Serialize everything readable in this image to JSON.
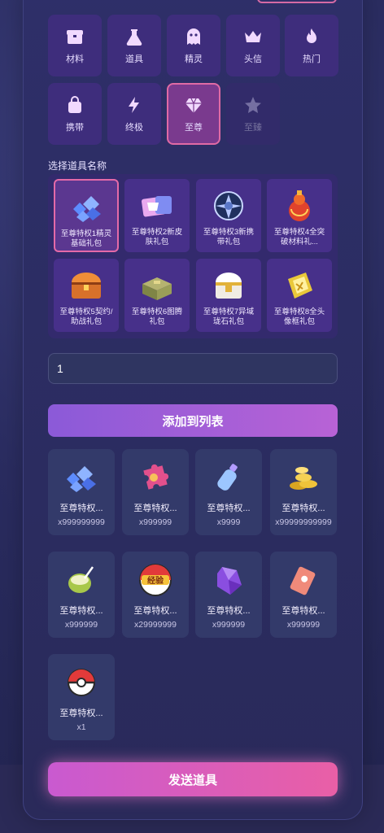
{
  "categories": [
    {
      "label": "材料",
      "icon": "box-icon",
      "state": "normal"
    },
    {
      "label": "道具",
      "icon": "flask-icon",
      "state": "normal"
    },
    {
      "label": "精灵",
      "icon": "ghost-icon",
      "state": "normal"
    },
    {
      "label": "头信",
      "icon": "crown-icon",
      "state": "normal"
    },
    {
      "label": "热门",
      "icon": "fire-icon",
      "state": "normal"
    },
    {
      "label": "携带",
      "icon": "bag-icon",
      "state": "normal"
    },
    {
      "label": "终极",
      "icon": "bolt-icon",
      "state": "normal"
    },
    {
      "label": "至尊",
      "icon": "diamond-icon",
      "state": "active"
    },
    {
      "label": "至臻",
      "icon": "star-icon",
      "state": "disabled"
    }
  ],
  "item_section_label": "选择道具名称",
  "packages": [
    {
      "name": "至尊特权1精灵基础礼包",
      "icon": "blue-crystals-icon",
      "selected": true
    },
    {
      "name": "至尊特权2新皮肤礼包",
      "icon": "skin-ticket-icon",
      "selected": false
    },
    {
      "name": "至尊特权3新携带礼包",
      "icon": "dark-star-badge-icon",
      "selected": false
    },
    {
      "name": "至尊特权4全突破材料礼...",
      "icon": "red-gourd-icon",
      "selected": false
    },
    {
      "name": "至尊特权5契约/助战礼包",
      "icon": "orange-chest-icon",
      "selected": false
    },
    {
      "name": "至尊特权6图腾礼包",
      "icon": "green-chest-icon",
      "selected": false
    },
    {
      "name": "至尊特权7异域珑石礼包",
      "icon": "gold-white-chest-icon",
      "selected": false
    },
    {
      "name": "至尊特权8全头像框礼包",
      "icon": "gold-frame-icon",
      "selected": false
    }
  ],
  "quantity_value": "1",
  "add_button_label": "添加到列表",
  "list_items": [
    {
      "name": "至尊特权...",
      "count": "x999999999",
      "icon": "blue-crystals-icon"
    },
    {
      "name": "至尊特权...",
      "count": "x999999",
      "icon": "puzzle-piece-icon"
    },
    {
      "name": "至尊特权...",
      "count": "x9999",
      "icon": "potion-bottle-icon"
    },
    {
      "name": "至尊特权...",
      "count": "x99999999999",
      "icon": "gold-coins-icon"
    },
    {
      "name": "至尊特权...",
      "count": "x999999",
      "icon": "coconut-drink-icon"
    },
    {
      "name": "至尊特权...",
      "count": "x29999999",
      "icon": "exp-ball-icon"
    },
    {
      "name": "至尊特权...",
      "count": "x999999",
      "icon": "purple-gem-icon"
    },
    {
      "name": "至尊特权...",
      "count": "x999999",
      "icon": "red-ticket-icon"
    },
    {
      "name": "至尊特权...",
      "count": "x1",
      "icon": "pokeball-icon"
    }
  ],
  "exp_ball_text": "经验",
  "send_button_label": "发送道具"
}
